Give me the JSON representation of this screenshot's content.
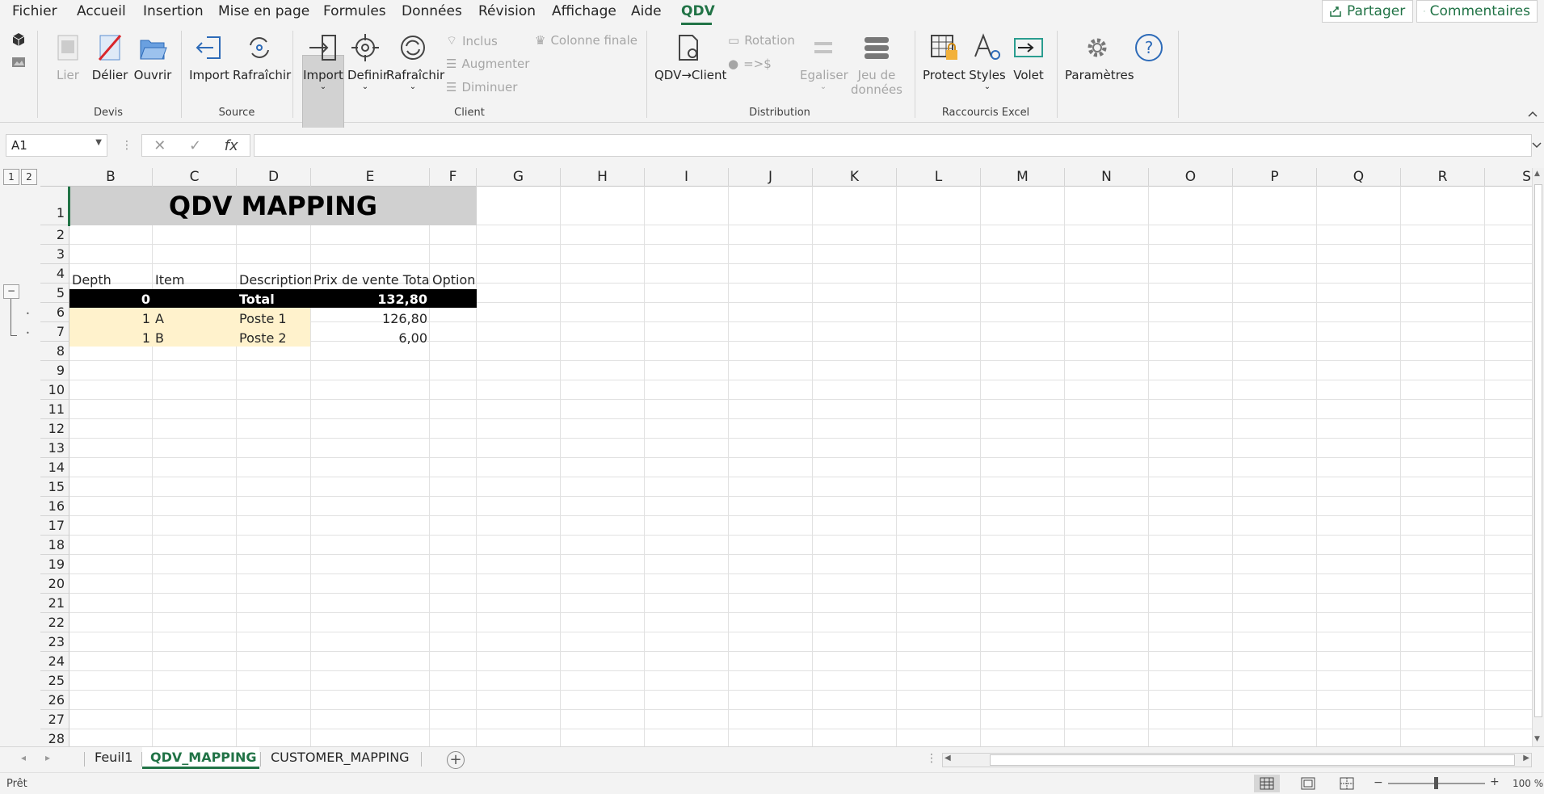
{
  "menu": {
    "items": [
      "Fichier",
      "Accueil",
      "Insertion",
      "Mise en page",
      "Formules",
      "Données",
      "Révision",
      "Affichage",
      "Aide",
      "QDV"
    ],
    "active": "QDV",
    "share_label": "Partager",
    "comments_label": "Commentaires"
  },
  "ribbon": {
    "devis": {
      "lier": "Lier",
      "delier": "Délier",
      "ouvrir": "Ouvrir",
      "label": "Devis"
    },
    "source": {
      "import": "Import",
      "rafraichir": "Rafraîchir",
      "label": "Source"
    },
    "client": {
      "import": "Import",
      "definir": "Definir",
      "rafraichir": "Rafraîchir",
      "inclus": "Inclus",
      "augmenter": "Augmenter",
      "diminuer": "Diminuer",
      "colonne_finale": "Colonne finale",
      "label": "Client"
    },
    "distribution": {
      "qdv_client": "QDV→Client",
      "rotation": "Rotation",
      "sign": "=>$",
      "egaliser": "Egaliser",
      "jeu1": "Jeu de",
      "jeu2": "données",
      "label": "Distribution"
    },
    "raccourcis": {
      "protect": "Protect",
      "styles": "Styles",
      "volet": "Volet",
      "label": "Raccourcis Excel"
    },
    "parametres": "Paramètres"
  },
  "formula_bar": {
    "name_box": "A1",
    "formula": "",
    "fx": "fx"
  },
  "outline": {
    "level1": "1",
    "level2": "2",
    "collapse": "−"
  },
  "columns": [
    "B",
    "C",
    "D",
    "E",
    "F",
    "G",
    "H",
    "I",
    "J",
    "K",
    "L",
    "M",
    "N",
    "O",
    "P",
    "Q",
    "R",
    "S"
  ],
  "rows": [
    "1",
    "2",
    "3",
    "4",
    "5",
    "6",
    "7",
    "8",
    "9",
    "10",
    "11",
    "12",
    "13",
    "14",
    "15",
    "16",
    "17",
    "18",
    "19",
    "20",
    "21",
    "22",
    "23",
    "24",
    "25",
    "26",
    "27",
    "28"
  ],
  "sheet": {
    "title": "QDV MAPPING",
    "headers": {
      "depth": "Depth",
      "item": "Item",
      "description": "Description",
      "prix": "Prix de vente Total",
      "option": "Option"
    },
    "total_row": {
      "depth": "0",
      "item": "",
      "description": "Total",
      "prix": "132,80"
    },
    "data_rows": [
      {
        "depth": "1",
        "item": "A",
        "description": "Poste 1",
        "prix": "126,80"
      },
      {
        "depth": "1",
        "item": "B",
        "description": "Poste 2",
        "prix": "6,00"
      }
    ]
  },
  "tabs": [
    "Feuil1",
    "QDV_MAPPING",
    "CUSTOMER_MAPPING"
  ],
  "active_tab": "QDV_MAPPING",
  "status": {
    "text": "Prêt",
    "zoom": "100 %"
  },
  "colors": {
    "accent": "#217346",
    "tan": "#fff2cc",
    "title_band": "#d0d0d0"
  }
}
